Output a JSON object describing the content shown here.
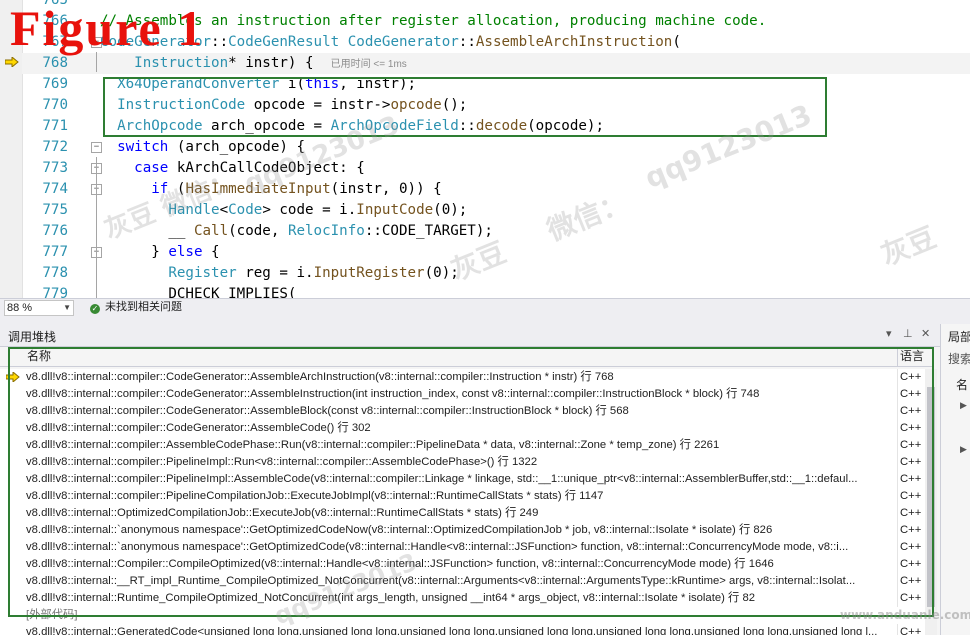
{
  "figure_label": "Figure 1",
  "editor": {
    "lines": [
      {
        "num": "765",
        "fold": "",
        "segments": [
          {
            "t": "  ",
            "c": ""
          }
        ]
      },
      {
        "num": "766",
        "fold": "",
        "segments": [
          {
            "t": "// Assembles an instruction after register allocation, producing machine code.",
            "c": "cm"
          }
        ]
      },
      {
        "num": "767",
        "fold": "-",
        "segments": [
          {
            "t": "CodeGenerator",
            "c": "ty"
          },
          {
            "t": "::",
            "c": ""
          },
          {
            "t": "CodeGenResult ",
            "c": "ty"
          },
          {
            "t": "CodeGenerator",
            "c": "ty"
          },
          {
            "t": "::",
            "c": ""
          },
          {
            "t": "AssembleArchInstruction",
            "c": "fn"
          },
          {
            "t": "(",
            "c": ""
          }
        ]
      },
      {
        "num": "768",
        "fold": "",
        "segments": [
          {
            "t": "    ",
            "c": ""
          },
          {
            "t": "Instruction",
            "c": "ty"
          },
          {
            "t": "* instr) {",
            "c": ""
          }
        ],
        "time": "已用时间 <= 1ms"
      },
      {
        "num": "769",
        "fold": "",
        "segments": [
          {
            "t": "  ",
            "c": ""
          },
          {
            "t": "X64OperandConverter",
            "c": "ty"
          },
          {
            "t": " i(",
            "c": ""
          },
          {
            "t": "this",
            "c": "kw"
          },
          {
            "t": ", instr);",
            "c": ""
          }
        ]
      },
      {
        "num": "770",
        "fold": "",
        "segments": [
          {
            "t": "  ",
            "c": ""
          },
          {
            "t": "InstructionCode",
            "c": "ty"
          },
          {
            "t": " opcode = instr->",
            "c": ""
          },
          {
            "t": "opcode",
            "c": "fn"
          },
          {
            "t": "();",
            "c": ""
          }
        ]
      },
      {
        "num": "771",
        "fold": "",
        "segments": [
          {
            "t": "  ",
            "c": ""
          },
          {
            "t": "ArchOpcode",
            "c": "ty"
          },
          {
            "t": " arch_opcode = ",
            "c": ""
          },
          {
            "t": "ArchOpcodeField",
            "c": "ty"
          },
          {
            "t": "::",
            "c": ""
          },
          {
            "t": "decode",
            "c": "fn"
          },
          {
            "t": "(opcode);",
            "c": ""
          }
        ]
      },
      {
        "num": "772",
        "fold": "-",
        "segments": [
          {
            "t": "  ",
            "c": ""
          },
          {
            "t": "switch",
            "c": "kw"
          },
          {
            "t": " (arch_opcode) {",
            "c": ""
          }
        ]
      },
      {
        "num": "773",
        "fold": "-",
        "segments": [
          {
            "t": "    ",
            "c": ""
          },
          {
            "t": "case",
            "c": "kw"
          },
          {
            "t": " kArchCallCodeObject: {",
            "c": ""
          }
        ]
      },
      {
        "num": "774",
        "fold": "-",
        "segments": [
          {
            "t": "      ",
            "c": ""
          },
          {
            "t": "if",
            "c": "kw"
          },
          {
            "t": " (",
            "c": ""
          },
          {
            "t": "HasImmediateInput",
            "c": "fn"
          },
          {
            "t": "(instr, 0)) {",
            "c": ""
          }
        ]
      },
      {
        "num": "775",
        "fold": "",
        "segments": [
          {
            "t": "        ",
            "c": ""
          },
          {
            "t": "Handle",
            "c": "ty"
          },
          {
            "t": "<",
            "c": ""
          },
          {
            "t": "Code",
            "c": "ty"
          },
          {
            "t": "> code = i.",
            "c": ""
          },
          {
            "t": "InputCode",
            "c": "fn"
          },
          {
            "t": "(0);",
            "c": ""
          }
        ]
      },
      {
        "num": "776",
        "fold": "",
        "segments": [
          {
            "t": "        ",
            "c": ""
          },
          {
            "t": "__ ",
            "c": ""
          },
          {
            "t": "Call",
            "c": "fn"
          },
          {
            "t": "(code, ",
            "c": ""
          },
          {
            "t": "RelocInfo",
            "c": "ty"
          },
          {
            "t": "::CODE_TARGET);",
            "c": ""
          }
        ]
      },
      {
        "num": "777",
        "fold": "-",
        "segments": [
          {
            "t": "      } ",
            "c": ""
          },
          {
            "t": "else",
            "c": "kw"
          },
          {
            "t": " {",
            "c": ""
          }
        ]
      },
      {
        "num": "778",
        "fold": "",
        "segments": [
          {
            "t": "        ",
            "c": ""
          },
          {
            "t": "Register",
            "c": "ty"
          },
          {
            "t": " reg = i.",
            "c": ""
          },
          {
            "t": "InputRegister",
            "c": "fn"
          },
          {
            "t": "(0);",
            "c": ""
          }
        ]
      },
      {
        "num": "779",
        "fold": "",
        "segments": [
          {
            "t": "        DCHECK_IMPLIES(",
            "c": ""
          }
        ]
      }
    ],
    "zoom": "88 %",
    "issues_text": "未找到相关问题"
  },
  "call_stack": {
    "title": "调用堆栈",
    "col_name": "名称",
    "col_lang": "语言",
    "rows": [
      {
        "frame": "v8.dll!v8::internal::compiler::CodeGenerator::AssembleArchInstruction(v8::internal::compiler::Instruction * instr) 行 768",
        "lang": "C++",
        "current": true
      },
      {
        "frame": "v8.dll!v8::internal::compiler::CodeGenerator::AssembleInstruction(int instruction_index, const v8::internal::compiler::InstructionBlock * block) 行 748",
        "lang": "C++"
      },
      {
        "frame": "v8.dll!v8::internal::compiler::CodeGenerator::AssembleBlock(const v8::internal::compiler::InstructionBlock * block) 行 568",
        "lang": "C++"
      },
      {
        "frame": "v8.dll!v8::internal::compiler::CodeGenerator::AssembleCode() 行 302",
        "lang": "C++"
      },
      {
        "frame": "v8.dll!v8::internal::compiler::AssembleCodePhase::Run(v8::internal::compiler::PipelineData * data, v8::internal::Zone * temp_zone) 行 2261",
        "lang": "C++"
      },
      {
        "frame": "v8.dll!v8::internal::compiler::PipelineImpl::Run<v8::internal::compiler::AssembleCodePhase>() 行 1322",
        "lang": "C++"
      },
      {
        "frame": "v8.dll!v8::internal::compiler::PipelineImpl::AssembleCode(v8::internal::compiler::Linkage * linkage, std::__1::unique_ptr<v8::internal::AssemblerBuffer,std::__1::defaul...",
        "lang": "C++"
      },
      {
        "frame": "v8.dll!v8::internal::compiler::PipelineCompilationJob::ExecuteJobImpl(v8::internal::RuntimeCallStats * stats) 行 1147",
        "lang": "C++"
      },
      {
        "frame": "v8.dll!v8::internal::OptimizedCompilationJob::ExecuteJob(v8::internal::RuntimeCallStats * stats) 行 249",
        "lang": "C++"
      },
      {
        "frame": "v8.dll!v8::internal::`anonymous namespace'::GetOptimizedCodeNow(v8::internal::OptimizedCompilationJob * job, v8::internal::Isolate * isolate) 行 826",
        "lang": "C++"
      },
      {
        "frame": "v8.dll!v8::internal::`anonymous namespace'::GetOptimizedCode(v8::internal::Handle<v8::internal::JSFunction> function, v8::internal::ConcurrencyMode mode, v8::i...",
        "lang": "C++"
      },
      {
        "frame": "v8.dll!v8::internal::Compiler::CompileOptimized(v8::internal::Handle<v8::internal::JSFunction> function, v8::internal::ConcurrencyMode mode) 行 1646",
        "lang": "C++"
      },
      {
        "frame": "v8.dll!v8::internal::__RT_impl_Runtime_CompileOptimized_NotConcurrent(v8::internal::Arguments<v8::internal::ArgumentsType::kRuntime> args, v8::internal::Isolat...",
        "lang": "C++"
      },
      {
        "frame": "v8.dll!v8::internal::Runtime_CompileOptimized_NotConcurrent(int args_length, unsigned __int64 * args_object, v8::internal::Isolate * isolate) 行 82",
        "lang": "C++"
      },
      {
        "frame": "[外部代码]",
        "lang": "",
        "external": true
      },
      {
        "frame": "v8.dll!v8::internal::GeneratedCode<unsigned long long,unsigned long long,unsigned long long,unsigned long long,unsigned long long,unsigned long long,unsigned long l...",
        "lang": "C++"
      }
    ]
  },
  "locals": {
    "title": "局部",
    "search": "搜索",
    "col": "名"
  },
  "watermarks": [
    "qq9123013",
    "灰豆 微信：",
    "qq9123013",
    "灰豆",
    "微信：",
    "灰豆",
    "qq9123013",
    "www.anduanle.com"
  ]
}
